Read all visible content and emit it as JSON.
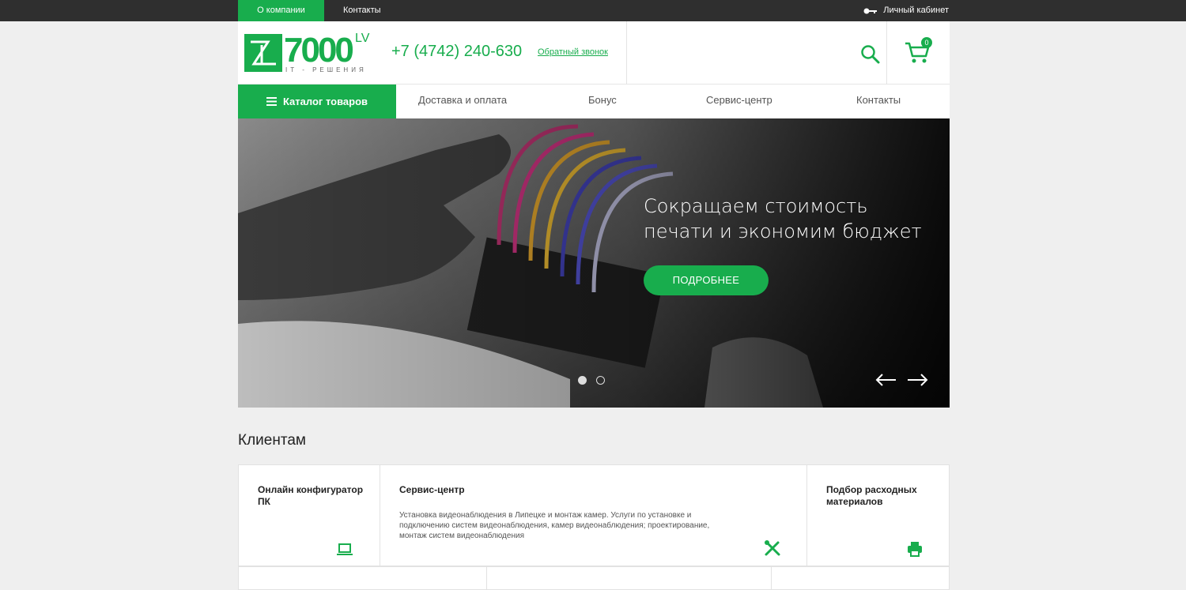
{
  "topbar": {
    "about_label": "О компании",
    "contacts_label": "Контакты",
    "cabinet_label": "Личный кабинет"
  },
  "header": {
    "logo_text": "7000",
    "logo_sup": "LV",
    "logo_sub": "IT - РЕШЕНИЯ",
    "phone": "+7 (4742) 240-630",
    "callback_label": "Обратный звонок",
    "cart_count": "0"
  },
  "nav": {
    "catalog_label": "Каталог товаров",
    "items": [
      "Доставка и оплата",
      "Бонус",
      "Сервис-центр",
      "Контакты"
    ]
  },
  "slider": {
    "title_line1": "Сокращаем стоимость",
    "title_line2": "печати и экономим бюджет",
    "button_label": "ПОДРОБНЕЕ"
  },
  "clients": {
    "title": "Клиентам",
    "cards": [
      {
        "title": "Онлайн конфигуратор ПК",
        "icon": "laptop-icon"
      },
      {
        "title": "Сервис-центр",
        "desc": "Установка видеонаблюдения в Липецке и монтаж камер. Услуги по установке и подключению систем видеонаблюдения, камер видеонаблюдения; проектирование, монтаж систем видеонаблюдения",
        "icon": "tools-icon"
      },
      {
        "title": "Подбор расходных материалов",
        "icon": "printer-icon"
      }
    ]
  },
  "colors": {
    "accent": "#18ad4d",
    "topbar": "#2f2f2f",
    "page_bg": "#efefef"
  }
}
